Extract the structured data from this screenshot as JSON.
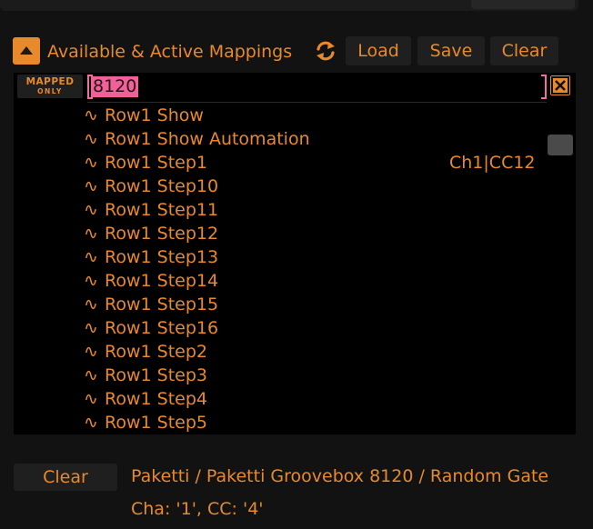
{
  "header": {
    "title": "Available & Active Mappings",
    "load_label": "Load",
    "save_label": "Save",
    "clear_label": "Clear"
  },
  "filter": {
    "mapped_only_line1": "MAPPED",
    "mapped_only_line2": "ONLY",
    "search_value": "8120"
  },
  "rows": [
    {
      "icon": "∿",
      "label": "Row1 Show",
      "mapping": ""
    },
    {
      "icon": "∿",
      "label": "Row1 Show Automation",
      "mapping": ""
    },
    {
      "icon": "∿",
      "label": "Row1 Step1",
      "mapping": "Ch1|CC12"
    },
    {
      "icon": "∿",
      "label": "Row1 Step10",
      "mapping": ""
    },
    {
      "icon": "∿",
      "label": "Row1 Step11",
      "mapping": ""
    },
    {
      "icon": "∿",
      "label": "Row1 Step12",
      "mapping": ""
    },
    {
      "icon": "∿",
      "label": "Row1 Step13",
      "mapping": ""
    },
    {
      "icon": "∿",
      "label": "Row1 Step14",
      "mapping": ""
    },
    {
      "icon": "∿",
      "label": "Row1 Step15",
      "mapping": ""
    },
    {
      "icon": "∿",
      "label": "Row1 Step16",
      "mapping": ""
    },
    {
      "icon": "∿",
      "label": "Row1 Step2",
      "mapping": ""
    },
    {
      "icon": "∿",
      "label": "Row1 Step3",
      "mapping": ""
    },
    {
      "icon": "∿",
      "label": "Row1 Step4",
      "mapping": ""
    },
    {
      "icon": "∿",
      "label": "Row1 Step5",
      "mapping": ""
    }
  ],
  "footer": {
    "clear_label": "Clear",
    "selected_path": "Paketti / Paketti Groovebox 8120 / Random Gate",
    "selected_info": "Cha: '1', CC: '4'"
  },
  "colors": {
    "accent": "#e8892b",
    "search_highlight": "#f0609a",
    "background": "#121212",
    "panel": "#000000",
    "button": "#1f1f1f"
  }
}
